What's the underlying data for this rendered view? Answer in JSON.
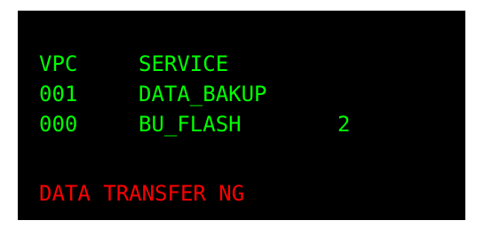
{
  "colors": {
    "screen_background": "#000000",
    "normal_text": "#00ff00",
    "error_text": "#ff0000"
  },
  "table": {
    "headers": [
      "VPC",
      "SERVICE"
    ],
    "rows": [
      {
        "vpc": "001",
        "service": "DATA_BAKUP",
        "value": ""
      },
      {
        "vpc": "000",
        "service": "BU_FLASH",
        "value": "2"
      }
    ]
  },
  "status_message": "DATA TRANSFER NG"
}
